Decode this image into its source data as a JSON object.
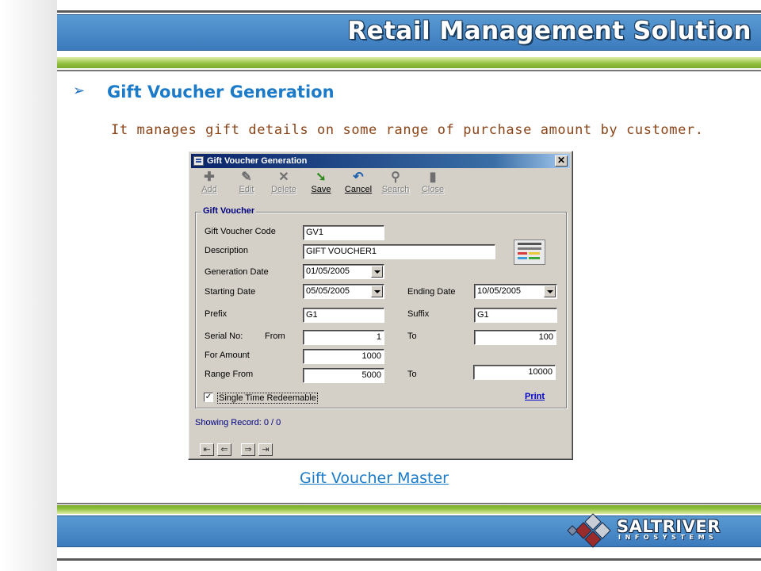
{
  "header": {
    "title": "Retail Management Solution"
  },
  "section": {
    "bullet": "➢",
    "title": "Gift Voucher Generation",
    "description": "It manages gift details on some range of purchase amount by customer."
  },
  "window": {
    "title": "Gift Voucher Generation",
    "close_glyph": "✕",
    "toolbar": [
      {
        "label": "Add",
        "icon": "add-icon",
        "glyph": "✚",
        "enabled": false
      },
      {
        "label": "Edit",
        "icon": "edit-icon",
        "glyph": "✎",
        "enabled": false
      },
      {
        "label": "Delete",
        "icon": "delete-icon",
        "glyph": "✕",
        "enabled": false
      },
      {
        "label": "Save",
        "icon": "save-icon",
        "glyph": "➘",
        "enabled": true
      },
      {
        "label": "Cancel",
        "icon": "cancel-icon",
        "glyph": "↶",
        "enabled": true
      },
      {
        "label": "Search",
        "icon": "search-icon",
        "glyph": "⚲",
        "enabled": false
      },
      {
        "label": "Close",
        "icon": "close-door-icon",
        "glyph": "▮",
        "enabled": false
      }
    ],
    "group_title": "Gift Voucher",
    "form": {
      "voucher_code_label": "Gift Voucher Code",
      "voucher_code_value": "GV1",
      "description_label": "Description",
      "description_value": "GIFT VOUCHER1",
      "generation_date_label": "Generation Date",
      "generation_date_value": "01/05/2005",
      "starting_date_label": "Starting Date",
      "starting_date_value": "05/05/2005",
      "ending_date_label": "Ending Date",
      "ending_date_value": "10/05/2005",
      "prefix_label": "Prefix",
      "prefix_value": "G1",
      "suffix_label": "Suffix",
      "suffix_value": "G1",
      "serial_label": "Serial No:",
      "from_label": "From",
      "serial_from_value": "1",
      "to_label": "To",
      "serial_to_value": "100",
      "amount_label": "For Amount",
      "amount_value": "1000",
      "range_from_label": "Range From",
      "range_from_value": "5000",
      "range_to_label": "To",
      "range_to_value": "10000",
      "single_time_label": "Single Time Redeemable",
      "single_time_checked": true,
      "check_glyph": "✓",
      "print_label": "Print"
    },
    "status": "Showing Record: 0 / 0",
    "nav": [
      {
        "icon": "first-record-icon",
        "glyph": "⇤"
      },
      {
        "icon": "previous-record-icon",
        "glyph": "⇐"
      },
      {
        "icon": "next-record-icon",
        "glyph": "⇒"
      },
      {
        "icon": "last-record-icon",
        "glyph": "⇥"
      }
    ]
  },
  "caption": "Gift Voucher Master",
  "footer": {
    "logo_name": "SALTRIVER",
    "logo_sub": "INFOSYSTEMS"
  },
  "colors": {
    "header_blue": "#3b7bbd",
    "accent_green": "#8fbf3c",
    "title_blue": "#1b7bc8",
    "description_brown": "#8a4418",
    "win_titlebar": "#0a246a"
  }
}
